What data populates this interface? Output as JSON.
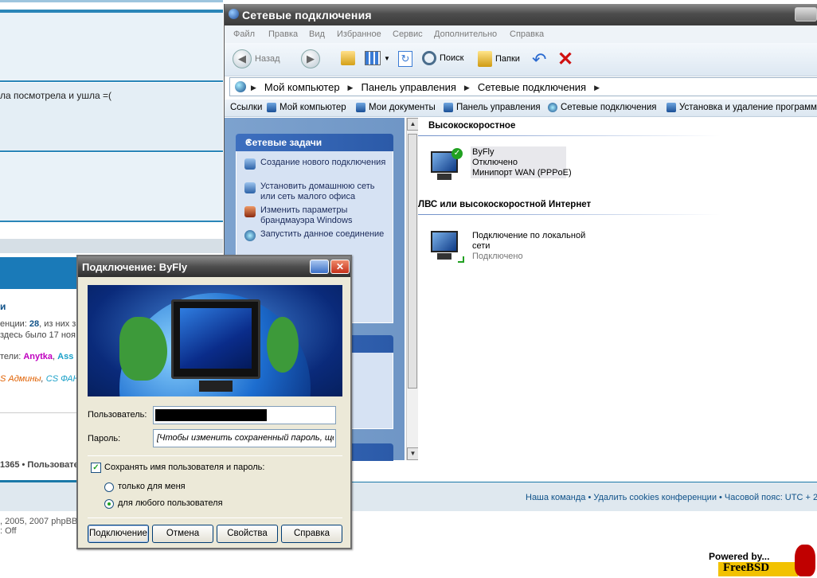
{
  "forum": {
    "post_text": "ла посмотрела и ушла =(",
    "section_link": "и",
    "online_line1_prefix": "енции: ",
    "online_count": "28",
    "online_line1_suffix": ", из них за",
    "online_line2": "здесь было 17 ноя",
    "users_prefix": "тели: ",
    "user1": "Anytka",
    "user2": "Ass",
    "groups_prefix": "S Админы",
    "group2": "CS ФАН",
    "stats": "1365 • Пользовате",
    "footer_links": "Наша команда • Удалить cookies конференции • Часовой пояс: UTC + 2 ч",
    "copyright": ", 2005, 2007 phpBB",
    "gzip": ": Off",
    "powered_by": "Powered by...",
    "freebsd": "FreeBSD"
  },
  "explorer": {
    "title": "Сетевые подключения",
    "menu": [
      "Файл",
      "Правка",
      "Вид",
      "Избранное",
      "Сервис",
      "Дополнительно",
      "Справка"
    ],
    "toolbar": {
      "back": "Назад",
      "search": "Поиск",
      "folders": "Папки"
    },
    "address": [
      "Мой компьютер",
      "Панель управления",
      "Сетевые подключения"
    ],
    "links_label": "Ссылки",
    "links": [
      "Мой компьютер",
      "Мои документы",
      "Панель управления",
      "Сетевые подключения",
      "Установка и удаление программ"
    ],
    "tasks_header": "Сетевые задачи",
    "tasks": [
      "Создание нового подключения",
      "Установить домашнюю сеть или сеть малого офиса",
      "Изменить параметры брандмауэра Windows",
      "Запустить данное соединение"
    ],
    "groups": {
      "broadband": "Высокоскоростное",
      "lan": "ЛВС или высокоскоростной Интернет"
    },
    "connections": [
      {
        "name": "ByFly",
        "status": "Отключено",
        "device": "Минипорт WAN (PPPoE)"
      },
      {
        "name": "Подключение по локальной сети",
        "status": "Подключено"
      }
    ]
  },
  "dialog": {
    "title": "Подключение: ByFly",
    "user_label": "Пользователь:",
    "password_label": "Пароль:",
    "password_placeholder": "[Чтобы изменить сохраненный пароль, щел",
    "save_label": "Сохранять имя пользователя и пароль:",
    "save_checked": true,
    "radio_me": "только для меня",
    "radio_all": "для любого пользователя",
    "selected_radio": "для любого пользователя",
    "buttons": {
      "connect": "Подключение",
      "cancel": "Отмена",
      "properties": "Свойства",
      "help": "Справка"
    }
  },
  "colors": {
    "forum_accent": "#2a86b8",
    "xp_task_blue": "#2b5aa8",
    "connected_check": "#21a121"
  }
}
